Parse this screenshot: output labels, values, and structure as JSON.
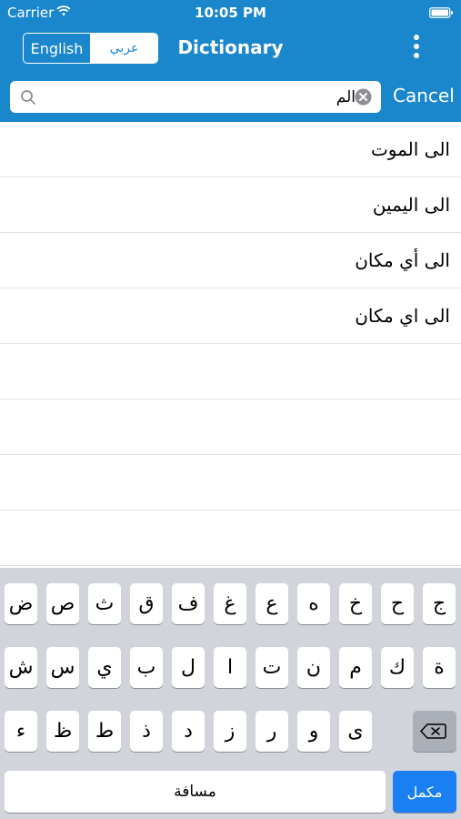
{
  "status_bar": {
    "carrier": "Carrier",
    "time": "10:05 PM"
  },
  "nav": {
    "segment_english": "English",
    "segment_arabic": "عربي",
    "selected_segment": "عربي",
    "title": "Dictionary"
  },
  "search": {
    "value": "الم",
    "cancel_label": "Cancel"
  },
  "results": [
    "الى الموت",
    "الى اليمين",
    "الى أي مكان",
    "الى اي مكان"
  ],
  "keyboard": {
    "row1": [
      "ض",
      "ص",
      "ث",
      "ق",
      "ف",
      "غ",
      "ع",
      "ه",
      "خ",
      "ح",
      "ج"
    ],
    "row2": [
      "ش",
      "س",
      "ي",
      "ب",
      "ل",
      "ا",
      "ت",
      "ن",
      "م",
      "ك",
      "ة"
    ],
    "row3": [
      "ء",
      "ظ",
      "ط",
      "ذ",
      "د",
      "ز",
      "ر",
      "و",
      "ى"
    ],
    "space_label": "مسافة",
    "done_label": "مكمل"
  },
  "colors": {
    "header": "#1a86cc",
    "keyboard_bg": "#d1d5db",
    "done_key": "#1a7ff2"
  },
  "icons": [
    "wifi-icon",
    "battery-icon",
    "more-vertical-icon",
    "search-icon",
    "clear-icon",
    "backspace-icon"
  ]
}
